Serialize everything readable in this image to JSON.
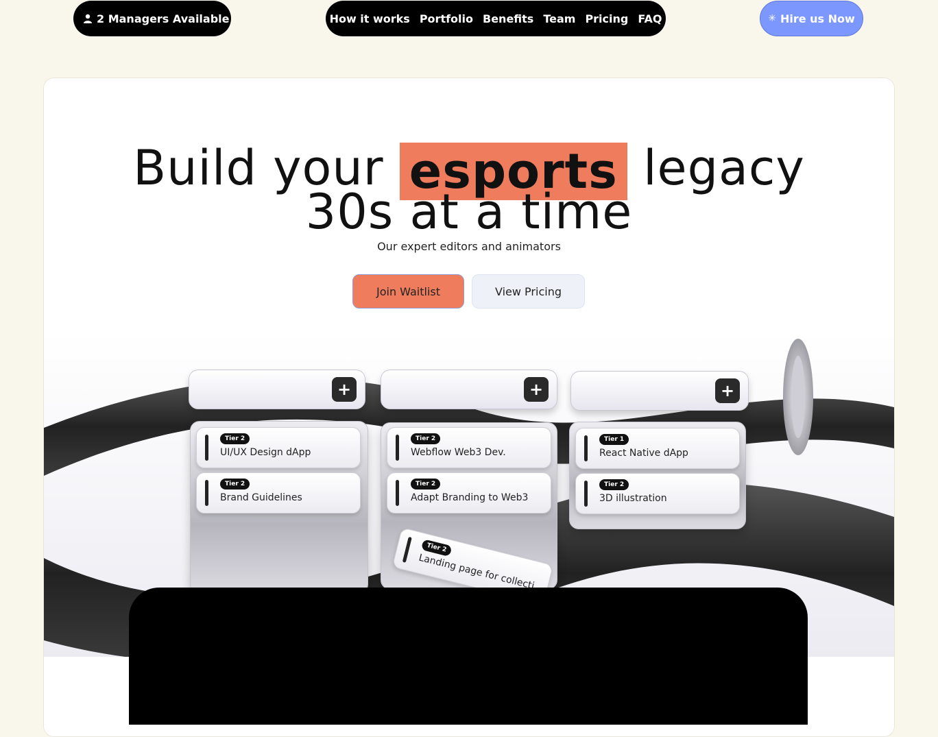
{
  "topbar": {
    "managers_label": "2 Managers Available",
    "nav": [
      "How it works",
      "Portfolio",
      "Benefits",
      "Team",
      "Pricing",
      "FAQ"
    ],
    "hire_label": "Hire us Now"
  },
  "hero": {
    "headline_pre": "Build your",
    "headline_highlight": "esports",
    "headline_post": "legacy",
    "headline_line2": "30s at a time",
    "subtitle": "Our expert editors and animators",
    "primary_button": "Join Waitlist",
    "secondary_button": "View Pricing"
  },
  "board": {
    "columns": [
      {
        "tasks": [
          {
            "tier": "Tier 2",
            "name": "UI/UX Design dApp"
          },
          {
            "tier": "Tier 2",
            "name": "Brand Guidelines"
          }
        ]
      },
      {
        "tasks": [
          {
            "tier": "Tier 2",
            "name": "Webflow Web3 Dev."
          },
          {
            "tier": "Tier 2",
            "name": "Adapt Branding to Web3"
          },
          {
            "tier": "Tier 2",
            "name": "Landing page for collecti"
          }
        ]
      },
      {
        "tasks": [
          {
            "tier": "Tier 1",
            "name": "React Native dApp"
          },
          {
            "tier": "Tier 2",
            "name": "3D illustration"
          }
        ]
      }
    ]
  },
  "colors": {
    "page_bg": "#f9f6ec",
    "accent_orange": "#ef7c5c",
    "hire_blue": "#7c98ff",
    "nav_black": "#000000"
  },
  "icons": [
    "user-icon",
    "sparkle-icon",
    "plus-icon"
  ]
}
